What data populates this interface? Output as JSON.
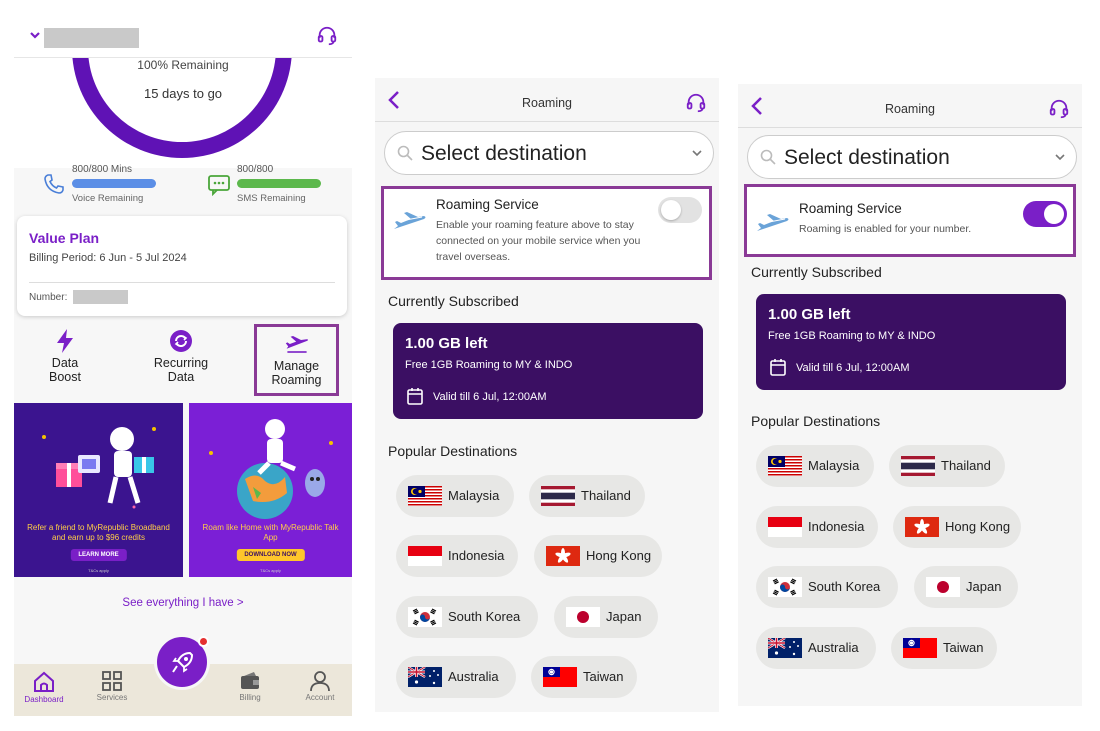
{
  "colors": {
    "brand": "#7a1fc7",
    "card_dark": "#3b0f63",
    "highlight": "#8a3a96",
    "voice_bar": "#5b8ee6",
    "sms_bar": "#5cb84c"
  },
  "dashboard": {
    "ring": {
      "remaining": "100% Remaining",
      "days": "15 days to go"
    },
    "voice": {
      "top": "800/800 Mins",
      "sub": "Voice Remaining",
      "fraction": 1.0,
      "icon": "phone-icon"
    },
    "sms": {
      "top": "800/800",
      "sub": "SMS Remaining",
      "fraction": 1.0,
      "icon": "sms-icon"
    },
    "plan": {
      "title": "Value Plan",
      "period": "Billing Period: 6 Jun - 5 Jul 2024",
      "number_label": "Number:"
    },
    "quick_actions": [
      {
        "label": "Data Boost",
        "icon": "lightning-icon"
      },
      {
        "label": "Recurring Data",
        "icon": "recurring-icon"
      },
      {
        "label": "Manage Roaming",
        "icon": "airplane-icon"
      }
    ],
    "banners": [
      {
        "text": "Refer a friend to MyRepublic Broadband and earn up to $96 credits",
        "button": "LEARN MORE",
        "tiny": "T&Cs apply"
      },
      {
        "text": "Roam like Home with MyRepublic Talk App",
        "button": "DOWNLOAD NOW",
        "tiny": "T&Cs apply"
      }
    ],
    "see_all": "See everything I have   >",
    "nav": [
      {
        "label": "Dashboard",
        "icon": "home-icon"
      },
      {
        "label": "Services",
        "icon": "grid-icon"
      },
      {
        "label": "Billing",
        "icon": "wallet-icon"
      },
      {
        "label": "Account",
        "icon": "person-icon"
      }
    ]
  },
  "roaming_off": {
    "title": "Roaming",
    "select_placeholder": "Select destination",
    "service_title": "Roaming Service",
    "service_desc": "Enable your roaming feature above to stay connected on your mobile service when you travel overseas.",
    "toggle_on": false,
    "subscribed_title": "Currently Subscribed",
    "sub": {
      "gb": "1.00 GB left",
      "desc": "Free 1GB Roaming to MY & INDO",
      "valid": "Valid till 6 Jul, 12:00AM"
    },
    "popular_title": "Popular Destinations"
  },
  "roaming_on": {
    "title": "Roaming",
    "select_placeholder": "Select destination",
    "service_title": "Roaming Service",
    "service_desc": "Roaming is enabled for your number.",
    "toggle_on": true,
    "subscribed_title": "Currently Subscribed",
    "sub": {
      "gb": "1.00 GB left",
      "desc": "Free 1GB Roaming to MY & INDO",
      "valid": "Valid till 6 Jul, 12:00AM"
    },
    "popular_title": "Popular Destinations"
  },
  "destinations": [
    "Malaysia",
    "Thailand",
    "Indonesia",
    "Hong Kong",
    "South Korea",
    "Japan",
    "Australia",
    "Taiwan"
  ]
}
